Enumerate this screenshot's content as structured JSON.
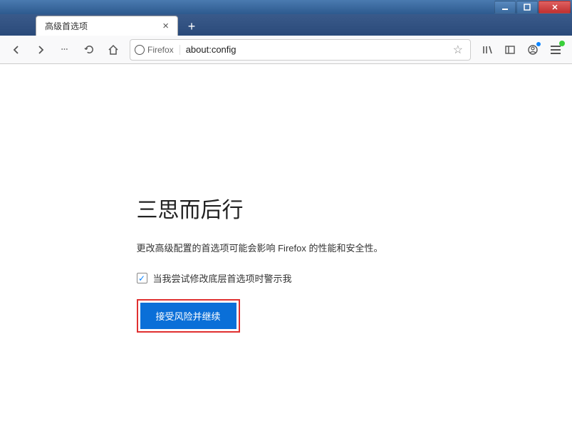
{
  "tab": {
    "title": "高级首选项"
  },
  "urlbar": {
    "identity_label": "Firefox",
    "url": "about:config"
  },
  "warning": {
    "title": "三思而后行",
    "description": "更改高级配置的首选项可能会影响 Firefox 的性能和安全性。",
    "checkbox_label": "当我尝试修改底层首选项时警示我",
    "checkbox_checked": true,
    "accept_button": "接受风险并继续"
  }
}
